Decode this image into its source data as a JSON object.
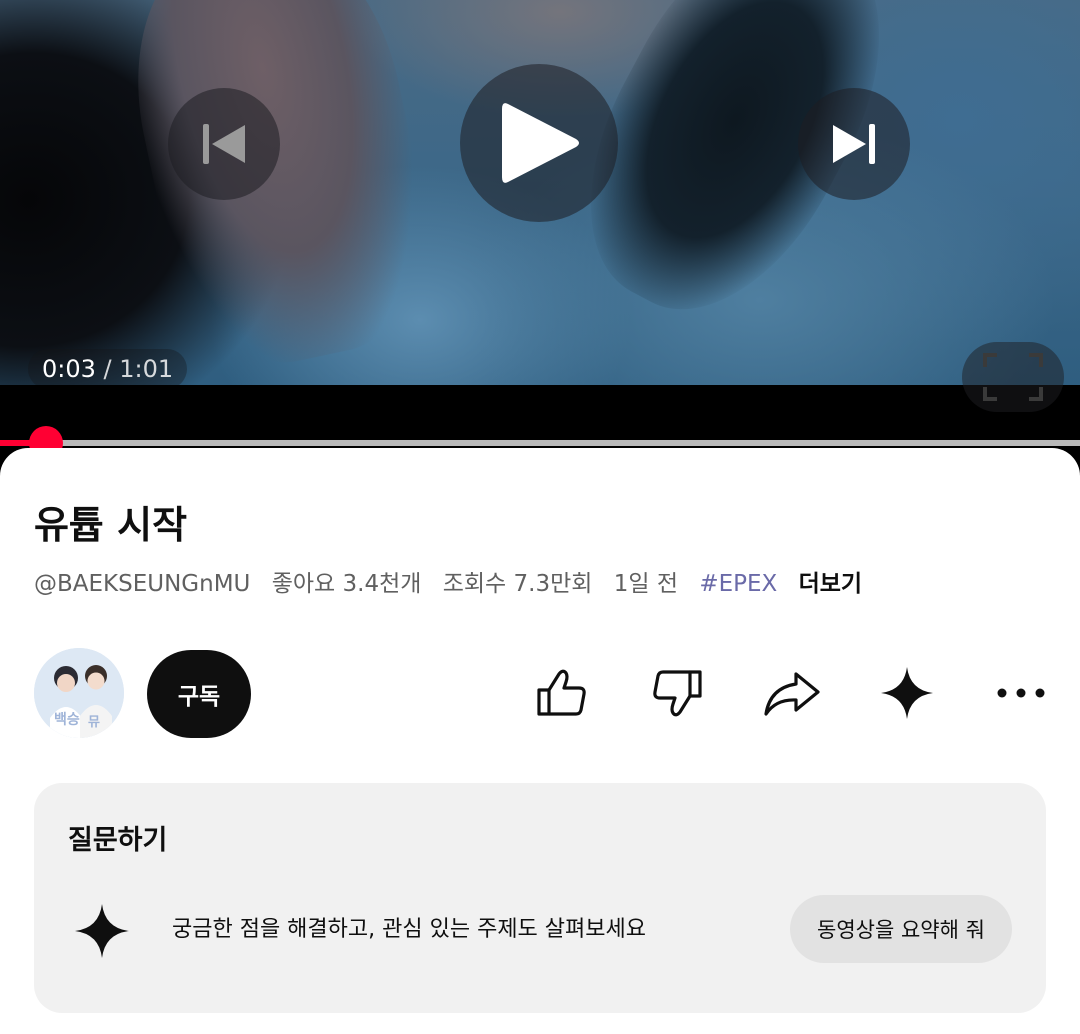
{
  "player": {
    "current_time": "0:03",
    "separator": "/",
    "duration": "1:01",
    "progress_fraction": 0.043,
    "accent": "#ff0033"
  },
  "video": {
    "title": "유튭 시작",
    "channel_handle": "@BAEKSEUNGnMU",
    "likes": "좋아요 3.4천개",
    "views": "조회수 7.3만회",
    "age": "1일 전",
    "hashtag": "#EPEX",
    "more_label": "더보기"
  },
  "channel": {
    "subscribe_label": "구독"
  },
  "actions": {
    "like_icon": "thumbs-up-icon",
    "dislike_icon": "thumbs-down-icon",
    "share_icon": "share-icon",
    "ai_icon": "sparkle-icon",
    "more_icon": "more-options-icon"
  },
  "ask": {
    "title": "질문하기",
    "prompt": "궁금한 점을 해결하고, 관심 있는 주제도 살펴보세요",
    "chip_label": "동영상을 요약해 줘"
  }
}
